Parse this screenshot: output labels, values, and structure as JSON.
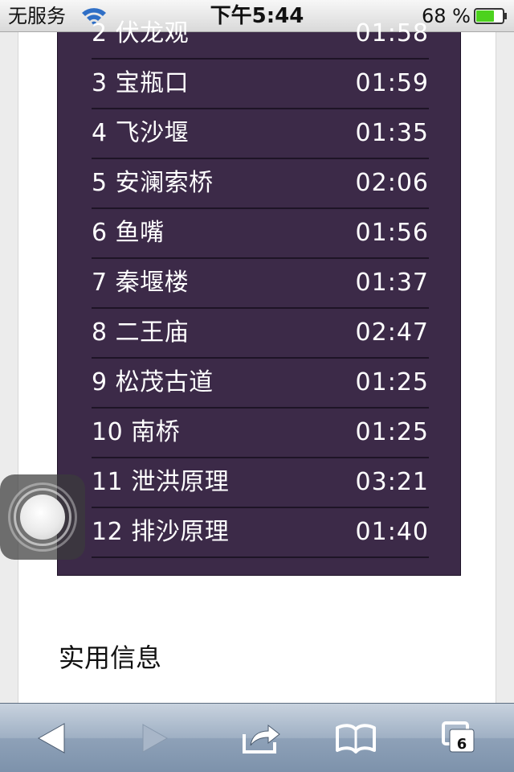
{
  "status_bar": {
    "carrier": "无服务",
    "time": "下午5:44",
    "battery_percent": "68 %",
    "battery_level": 0.68
  },
  "tracks": [
    {
      "title": "2 伏龙观",
      "time": "01:58"
    },
    {
      "title": "3 宝瓶口",
      "time": "01:59"
    },
    {
      "title": "4 飞沙堰",
      "time": "01:35"
    },
    {
      "title": "5 安澜索桥",
      "time": "02:06"
    },
    {
      "title": "6 鱼嘴",
      "time": "01:56"
    },
    {
      "title": "7 秦堰楼",
      "time": "01:37"
    },
    {
      "title": "8 二王庙",
      "time": "02:47"
    },
    {
      "title": "9 松茂古道",
      "time": "01:25"
    },
    {
      "title": "10 南桥",
      "time": "01:25"
    },
    {
      "title": "11 泄洪原理",
      "time": "03:21"
    },
    {
      "title": "12 排沙原理",
      "time": "01:40"
    }
  ],
  "section": {
    "title": "实用信息"
  },
  "toolbar": {
    "back_icon": "back-arrow-icon",
    "forward_icon": "forward-arrow-icon",
    "share_icon": "share-icon",
    "bookmarks_icon": "bookmarks-icon",
    "tabs_count": "6"
  },
  "colors": {
    "track_box_bg": "#3c2a48",
    "track_text": "#ffffff",
    "toolbar_top": "#c8d2de",
    "toolbar_bottom": "#7d92ab",
    "battery_green": "#4cd21e"
  }
}
